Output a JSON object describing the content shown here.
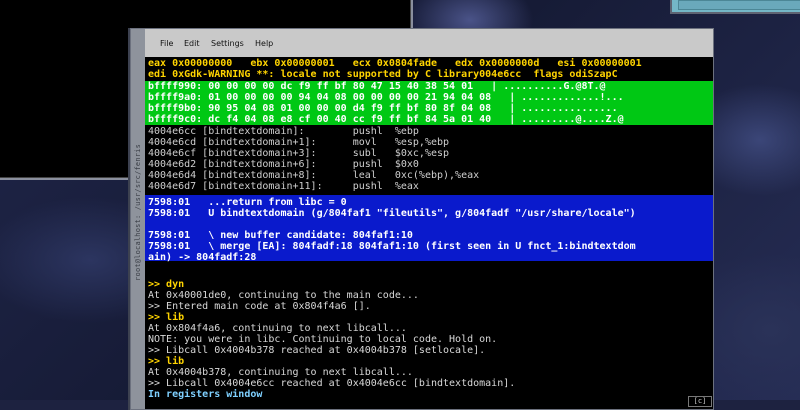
{
  "menu": [
    "File",
    "Edit",
    "Settings",
    "Help"
  ],
  "side_title": "root@localhost: /usr/src/fenris",
  "registers": [
    "eax 0x00000000   ebx 0x00000001   ecx 0x0804fade   edx 0x0000000d   esi 0x00000001",
    "edi 0xGdk-WARNING **: locale not supported by C library004e6cc  flags odiSzapC"
  ],
  "memory": [
    "bffff990: 00 00 00 00 dc f9 ff bf 80 47 15 40 38 54 01   | ..........G.@8T.@",
    "bffff9a0: 01 00 00 00 00 94 04 08 00 00 00 00 21 94 04 08   | .............!...",
    "bffff9b0: 90 95 04 08 01 00 00 00 d4 f9 ff bf 80 8f 04 08   | ................",
    "bffff9c0: dc f4 04 08 e8 cf 00 40 cc f9 ff bf 84 5a 01 40   | .........@....Z.@"
  ],
  "disasm": [
    "4004e6cc [bindtextdomain]:        pushl  %ebp",
    "4004e6cd [bindtextdomain+1]:      movl   %esp,%ebp",
    "4004e6cf [bindtextdomain+3]:      subl   $0xc,%esp",
    "4004e6d2 [bindtextdomain+6]:      pushl  $0x0",
    "4004e6d4 [bindtextdomain+8]:      leal   0xc(%ebp),%eax",
    "4004e6d7 [bindtextdomain+11]:     pushl  %eax"
  ],
  "trace": [
    "7598:01   ...return from libc = 0",
    "7598:01   U bindtextdomain (g/804faf1 \"fileutils\", g/804fadf \"/usr/share/locale\")",
    "",
    "7598:01   \\ new buffer candidate: 804faf1:10",
    "7598:01   \\ merge [EA]: 804fadf:18 804faf1:10 (first seen in U fnct_1:bindtextdom",
    "ain) -> 804fadf:28"
  ],
  "console": [
    {
      "kind": "cmd",
      "text": ">> dyn"
    },
    {
      "kind": "out",
      "text": "At 0x40001de0, continuing to the main code..."
    },
    {
      "kind": "out",
      "text": ">> Entered main code at 0x804f4a6 []."
    },
    {
      "kind": "cmd",
      "text": ">> lib"
    },
    {
      "kind": "out",
      "text": "At 0x804f4a6, continuing to next libcall..."
    },
    {
      "kind": "out",
      "text": "NOTE: you were in libc. Continuing to local code. Hold on."
    },
    {
      "kind": "out",
      "text": ">> Libcall 0x4004b378 reached at 0x4004b378 [setlocale]."
    },
    {
      "kind": "cmd",
      "text": ">> lib"
    },
    {
      "kind": "out",
      "text": "At 0x4004b378, continuing to next libcall..."
    },
    {
      "kind": "out",
      "text": ">> Libcall 0x4004e6cc reached at 0x4004e6cc [bindtextdomain]."
    },
    {
      "kind": "status",
      "text": "In registers window"
    }
  ],
  "scroll_btn": "[c]"
}
